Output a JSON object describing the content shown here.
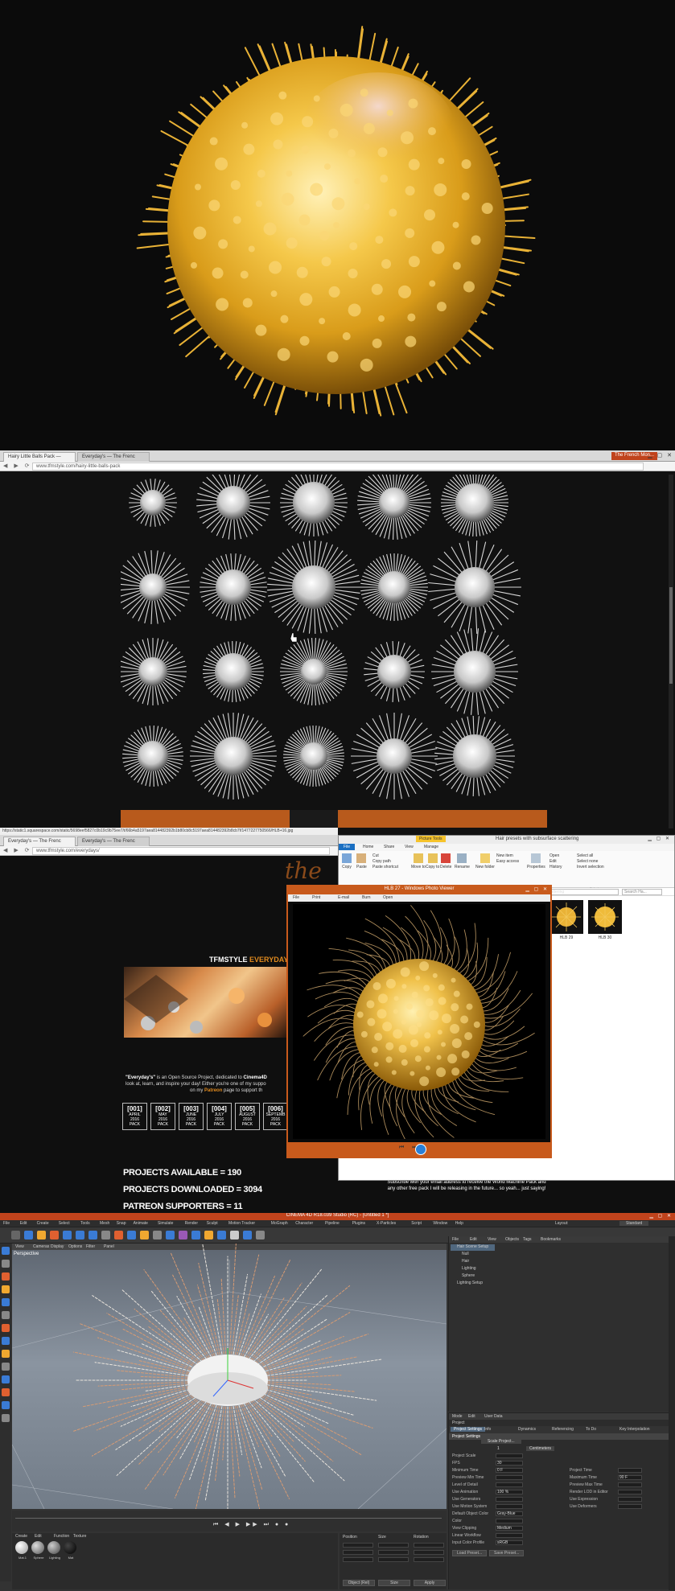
{
  "browser1": {
    "tab1": "Hairy Little Balls Pack —",
    "tab2": "Everyday's — The Frenc",
    "tab_right": "The French Mon...",
    "url": "www.tfmstyle.com/hairy-little-balls-pack",
    "status_url": "https://static1.squarespace.com/static/5698eef5827c0b19c9b75ee7/t/66b4a5197aea814482392b1b80cb8c5197aea814482392b8cb7f/1477227750566/HLB+16.jpg"
  },
  "browser2": {
    "tab1": "Everyday's — The Frenc",
    "tab2": "Everyday's — The Frenc",
    "url": "www.tfmstyle.com/everydays/",
    "header_tfmstyle": "TFMSTYLE",
    "header_everydays": "EVERYDAY'S",
    "header_pr": "PR",
    "intro_everydays": "\"Everyday's\"",
    "intro_text1": " is an Open Source Project, dedicated to ",
    "intro_cinema": "Cinema4D",
    "intro_text2": "look at, learn, and inspire your day! Either you're one of my suppo",
    "intro_text3": "on my ",
    "intro_patreon": "Patreon",
    "intro_text4": " page to support th",
    "packs": [
      {
        "n": "[001]",
        "m1": "APRIL",
        "m2": "2016",
        "m3": "PACK"
      },
      {
        "n": "[002]",
        "m1": "MAY",
        "m2": "2016",
        "m3": "PACK"
      },
      {
        "n": "[003]",
        "m1": "JUNE",
        "m2": "2016",
        "m3": "PACK"
      },
      {
        "n": "[004]",
        "m1": "JULY",
        "m2": "2016",
        "m3": "PACK"
      },
      {
        "n": "[005]",
        "m1": "AUGUST",
        "m2": "2016",
        "m3": "PACK"
      },
      {
        "n": "[006]",
        "m1": "SEPTEMB",
        "m2": "2016",
        "m3": "PACK"
      }
    ],
    "stat1": "PROJECTS AVAILABLE = 190",
    "stat2": "PROJECTS DOWNLOADED = 3094",
    "stat3": "PATREON SUPPORTERS = 11",
    "subscribe": "Subscribe with your email address to receive the World Machine Pack and any other free pack I will be releasing in the future... so yeah... just saying!"
  },
  "explorer": {
    "picture_tools": "Picture Tools",
    "title": "Hair presets with subsurface scattering",
    "tabs": {
      "file": "File",
      "home": "Home",
      "share": "Share",
      "view": "View",
      "manage": "Manage"
    },
    "buttons": {
      "copy": "Copy",
      "paste": "Paste",
      "cut": "Cut",
      "copy_path": "Copy path",
      "paste_shortcut": "Paste shortcut",
      "move_to": "Move to",
      "copy_to": "Copy to",
      "delete": "Delete",
      "rename": "Rename",
      "new_folder": "New folder",
      "new_item": "New item",
      "easy_access": "Easy access",
      "properties": "Properties",
      "open": "Open",
      "edit": "Edit",
      "history": "History",
      "select_all": "Select all",
      "select_none": "Select none",
      "invert_selection": "Invert selection"
    },
    "groups": {
      "clipboard": "Clipboard",
      "organize": "Organize",
      "new": "New",
      "open": "Open",
      "select": "Select"
    },
    "path": "cattering",
    "search": "Search Ha...",
    "thumb1": "HLB 29",
    "thumb2": "HLB 30"
  },
  "photoviewer": {
    "title": "HLB 27 - Windows Photo Viewer",
    "menu": {
      "file": "File",
      "print": "Print",
      "email": "E-mail",
      "burn": "Burn",
      "open": "Open"
    }
  },
  "c4d": {
    "title": "CINEMA 4D R18.039 Studio (RC) - [Untitled 1 *]",
    "menu": [
      "File",
      "Edit",
      "Create",
      "Select",
      "Tools",
      "Mesh",
      "Snap",
      "Animate",
      "Simulate",
      "Render",
      "Sculpt",
      "Motion Tracker",
      "MoGraph",
      "Character",
      "Pipeline",
      "Plugins",
      "X-Particles",
      "Script",
      "Window",
      "Help"
    ],
    "layout_label": "Layout:",
    "layout_value": "Standard",
    "vp_menu": [
      "View",
      "Cameras",
      "Display",
      "Options",
      "Filter",
      "Panel"
    ],
    "vp_label": "Perspective",
    "obj_menu": [
      "File",
      "Edit",
      "View",
      "Objects",
      "Tags",
      "Bookmarks"
    ],
    "objects": [
      "Hair Scene Setup",
      "Null",
      "Hair",
      "Lighting",
      "Sphere",
      "Lighting Setup"
    ],
    "attr_menu": [
      "Mode",
      "Edit",
      "User Data"
    ],
    "attr_header": "Project",
    "attr_tabs": [
      "Project Settings",
      "Info",
      "Dynamics",
      "Referencing",
      "To Do",
      "Key Interpolation"
    ],
    "attr_section": "Project Settings",
    "attr_rows_left": [
      "Project Scale",
      "FPS",
      "Minimum Time",
      "Preview Min Time",
      "Level of Detail",
      "Use Animation",
      "Use Generators",
      "Use Motion System",
      "Default Object Color",
      "Color",
      "View Clipping",
      "Linear Workflow",
      "Input Color Profile"
    ],
    "attr_rows_right": [
      "Project Time",
      "Maximum Time",
      "Preview Max Time",
      "Render LOD in Editor",
      "Use Expression",
      "Use Deformers"
    ],
    "attr_btn1": "Load Preset...",
    "attr_btn2": "Save Preset...",
    "scale_value": "1",
    "scale_unit": "Centimeters",
    "scale_btn": "Scale Project...",
    "fps": "30",
    "min_time": "0 F",
    "max_time": "90 F",
    "lod": "100 %",
    "obj_color": "Gray-Blue",
    "clipping": "Medium",
    "color_profile": "sRGB",
    "mat_menu": [
      "Create",
      "Edit",
      "Function",
      "Texture"
    ],
    "mat_names": [
      "Mat.1",
      "Sphere",
      "Lighting",
      "Mat"
    ],
    "coord_headers": [
      "Position",
      "Size",
      "Rotation"
    ],
    "coord_btn1": "Object (Rel)",
    "coord_btn2": "Size",
    "coord_btn3": "Apply"
  }
}
